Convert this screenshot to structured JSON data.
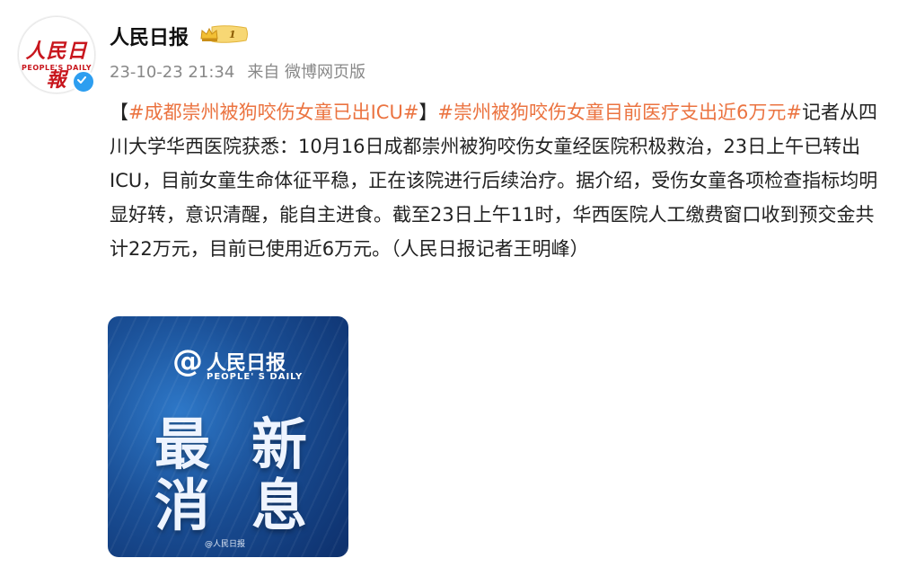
{
  "account": {
    "avatar_cn": "人民日報",
    "avatar_en": "PEOPLE'S DAILY",
    "name": "人民日报",
    "badge_level": "1"
  },
  "meta": {
    "timestamp": "23-10-23 21:34",
    "source": "来自 微博网页版"
  },
  "post": {
    "bracket_open": "【",
    "topic1": "#成都崇州被狗咬伤女童已出ICU#",
    "bracket_close": "】",
    "topic2": "#崇州被狗咬伤女童目前医疗支出近6万元#",
    "body": "记者从四川大学华西医院获悉：10月16日成都崇州被狗咬伤女童经医院积极救治，23日上午已转出ICU，目前女童生命体征平稳，正在该院进行后续治疗。据介绍，受伤女童各项检查指标均明显好转，意识清醒，能自主进食。截至23日上午11时，华西医院人工缴费窗口收到预交金共计22万元，目前已使用近6万元。（人民日报记者王明峰）"
  },
  "image": {
    "brand_at": "@",
    "brand_cn": "人民日报",
    "brand_en": "PEOPLE' S DAILY",
    "big_row1": [
      "最",
      "新"
    ],
    "big_row2": [
      "消",
      "息"
    ],
    "watermark": "@人民日报"
  },
  "colors": {
    "topic": "#eb7340",
    "verified": "#2d9ef0"
  }
}
